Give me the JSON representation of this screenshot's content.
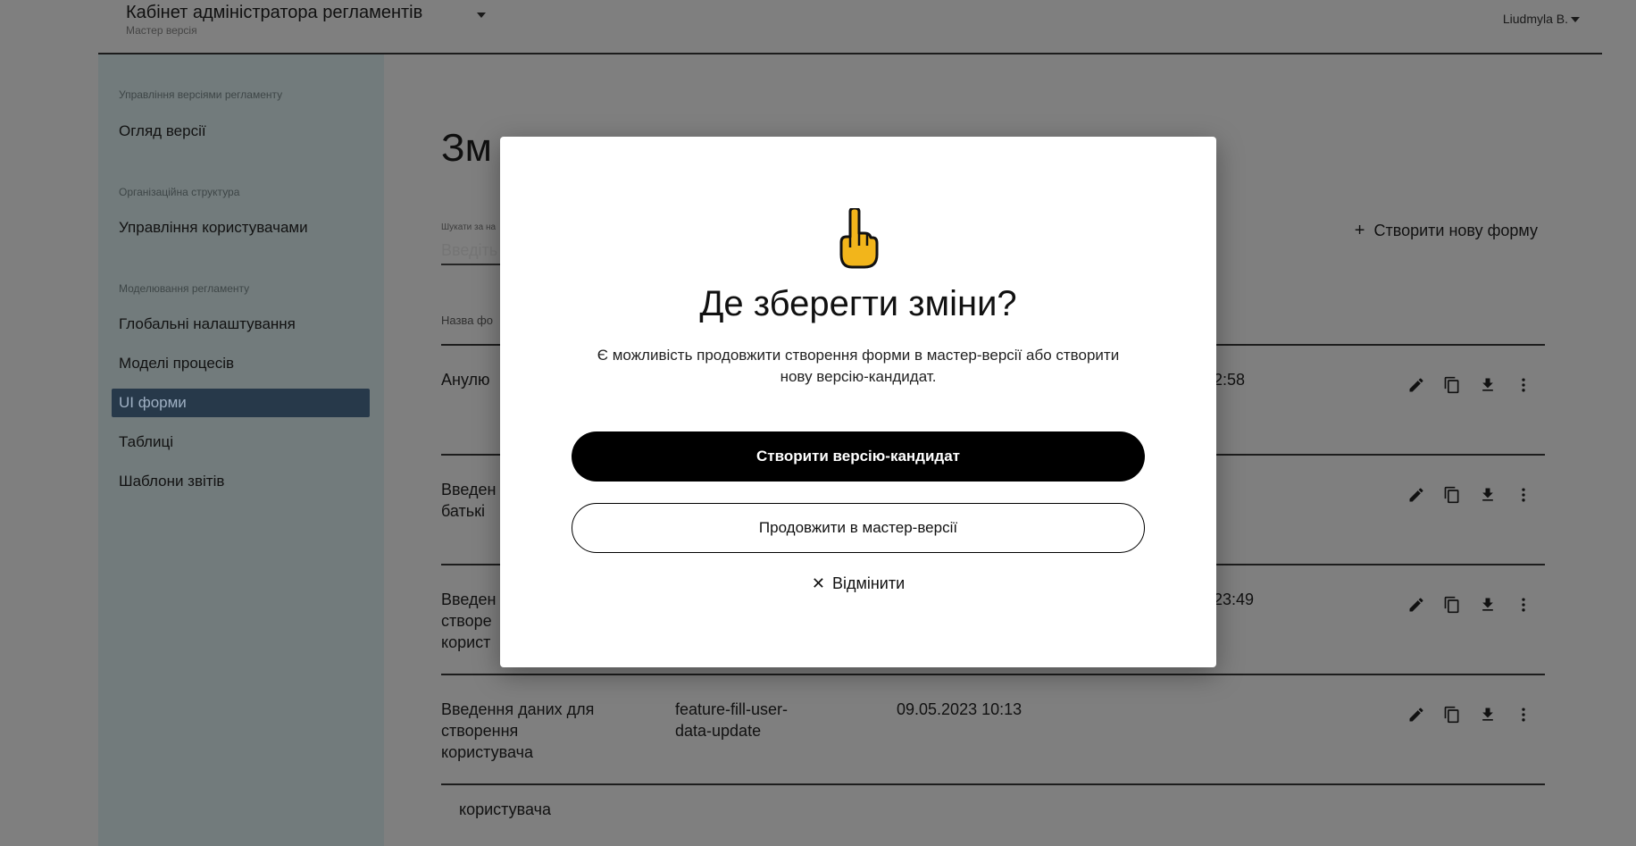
{
  "header": {
    "app_title": "Кабінет адміністратора регламентів",
    "version_label": "Мастер версія",
    "user_name": "Liudmyla B."
  },
  "sidebar": {
    "sections": [
      {
        "label": "Управління версіями регламенту",
        "items": [
          "Огляд версії"
        ]
      },
      {
        "label": "Організаційна структура",
        "items": [
          "Управління користувачами"
        ]
      },
      {
        "label": "Моделювання регламенту",
        "items": [
          "Глобальні налаштування",
          "Моделі процесів",
          "UI форми",
          "Таблиці",
          "Шаблони звітів"
        ]
      }
    ],
    "active_item": "UI форми"
  },
  "main": {
    "page_title_visible": "Зм",
    "search_label_visible": "Шукати за на",
    "search_placeholder_visible": "Введіть",
    "create_form_label": "Створити нову форму",
    "column_header_visible": "Назва фо",
    "rows": [
      {
        "name": "Анулю",
        "id": "",
        "date": "2:58"
      },
      {
        "name": "Введен\nбатькі",
        "id": "",
        "date": ""
      },
      {
        "name": "Введен\nстворе\nкорист",
        "id": "",
        "date": "23:49"
      },
      {
        "name": "Введення даних для\nстворення\nкористувача",
        "id": "feature-fill-user-\ndata-update",
        "date": "09.05.2023 10:13"
      }
    ],
    "bottom_row_text": "користувача"
  },
  "modal": {
    "emoji": "pointing-up-hand",
    "title": "Де зберегти зміни?",
    "description": "Є можливість продовжити створення форми в мастер-версії або створити нову версію-кандидат.",
    "primary_button": "Створити версію-кандидат",
    "secondary_button": "Продовжити в мастер-версії",
    "cancel_button": "Відмінити"
  }
}
